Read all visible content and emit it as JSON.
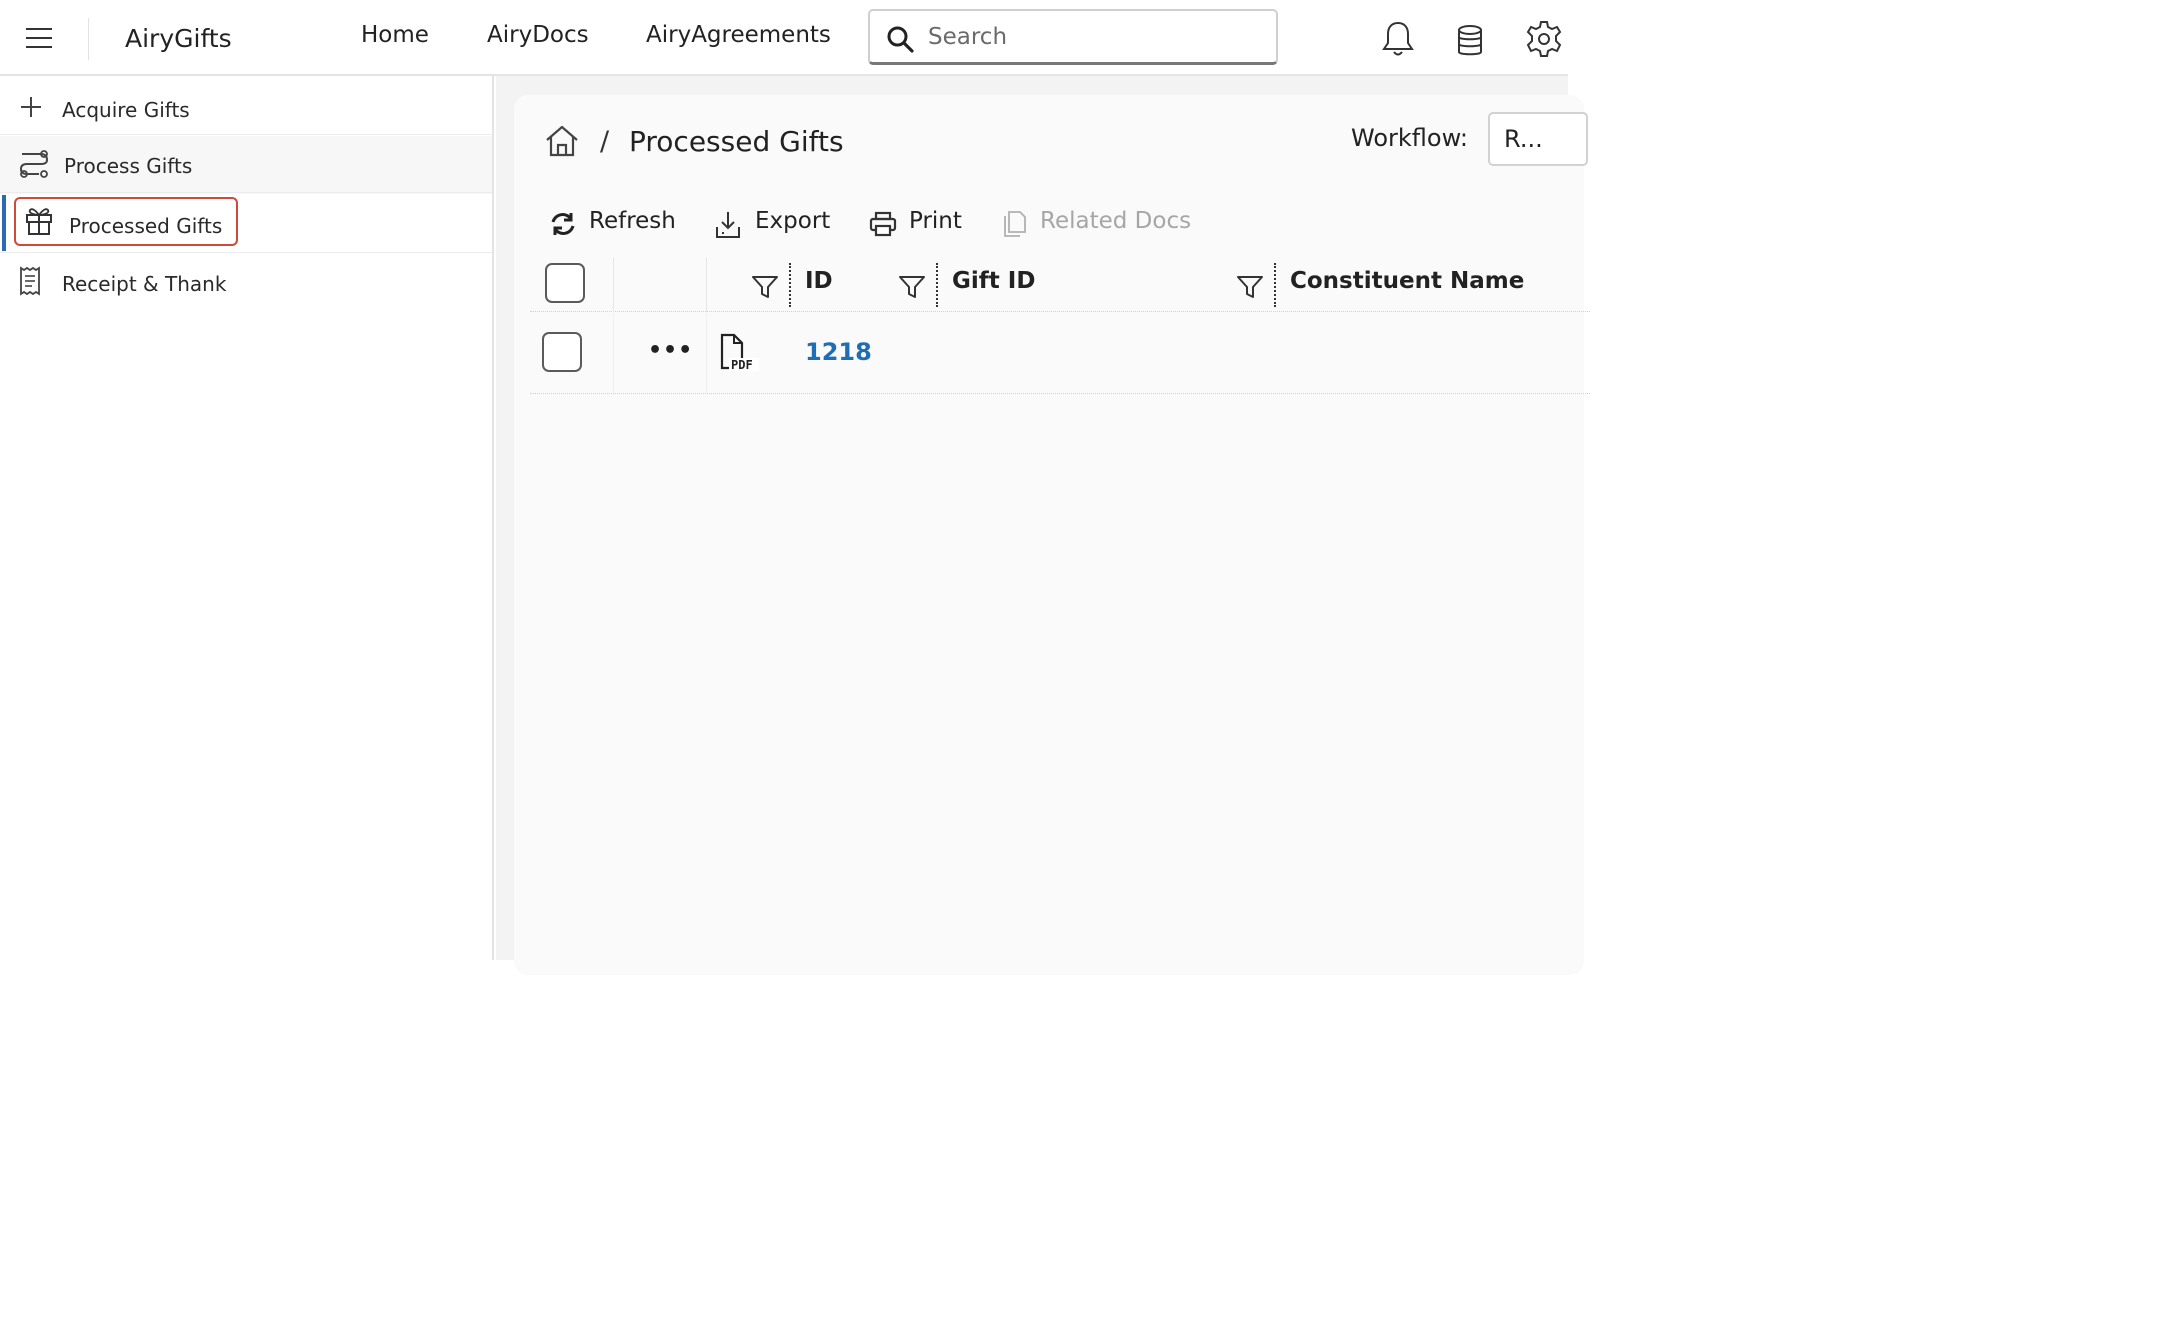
{
  "header": {
    "app_name": "AiryGifts",
    "nav": [
      "Home",
      "AiryDocs",
      "AiryAgreements"
    ],
    "search_placeholder": "Search"
  },
  "sidebar": {
    "items": [
      {
        "label": "Acquire Gifts",
        "icon": "plus-icon"
      },
      {
        "label": "Process Gifts",
        "icon": "process-flow-icon"
      },
      {
        "label": "Processed Gifts",
        "icon": "gift-icon",
        "active": true
      },
      {
        "label": "Receipt & Thank",
        "icon": "receipt-icon"
      }
    ]
  },
  "main": {
    "page_title": "Processed Gifts",
    "breadcrumb_separator": "/",
    "workflow_label": "Workflow:",
    "workflow_value": "R..."
  },
  "toolbar": {
    "refresh": "Refresh",
    "export": "Export",
    "print": "Print",
    "related_docs": "Related Docs"
  },
  "grid": {
    "columns": [
      "ID",
      "Gift ID",
      "Constituent Name"
    ],
    "rows": [
      {
        "more": "•••",
        "doc_type": "PDF",
        "id": "1218",
        "gift_id": "",
        "constituent_name": ""
      }
    ]
  },
  "colors": {
    "accent": "#2b6cb0",
    "link": "#1f6db5",
    "highlight_border": "#d04a3a",
    "disabled_text": "#a6a6a6"
  }
}
